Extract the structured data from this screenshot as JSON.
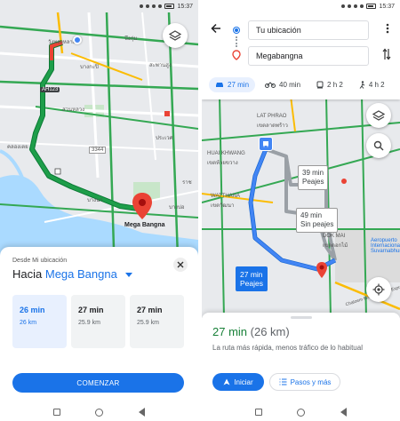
{
  "left": {
    "status": {
      "time": "15:37"
    },
    "map_labels": [
      "วังทองหลาง",
      "บางกะปิ",
      "บึงกุ่ม",
      "สะพานสูง",
      "AH123",
      "สวนหลวง",
      "ประเวศ",
      "คลองเตย",
      "3344",
      "บางนา",
      "Mega Bangna",
      "บางบ่อ",
      "ราช"
    ],
    "sheet": {
      "from_label": "Desde Mi ubicación",
      "to_prefix": "Hacia",
      "to_destination": "Mega Bangna",
      "options": [
        {
          "time": "26 min",
          "distance": "26 km"
        },
        {
          "time": "27 min",
          "distance": "25.9 km"
        },
        {
          "time": "27 min",
          "distance": "25.9 km"
        }
      ],
      "start_button": "COMENZAR"
    }
  },
  "right": {
    "status": {
      "time": "15:37"
    },
    "origin": "Tu ubicación",
    "destination": "Megabangna",
    "modes": [
      {
        "icon": "car-icon",
        "label": "27 min"
      },
      {
        "icon": "motorcycle-icon",
        "label": "40 min"
      },
      {
        "icon": "transit-icon",
        "label": "2 h 2"
      },
      {
        "icon": "walk-icon",
        "label": "4 h 2"
      }
    ],
    "map_labels": [
      "LAT PHRAO",
      "เขตลาดพร้าว",
      "HUAI KHWANG",
      "เขตห้วยขวาง",
      "WATTHANA",
      "เขตวัฒนา",
      "DOK MAI",
      "เขตดอกไม้",
      "Aeropuerto Internacional Suvarnabhumi",
      "Chaloem Maha Nakhon Expressway"
    ],
    "callouts": {
      "alt1_time": "39 min",
      "alt1_note": "Peajes",
      "alt2_time": "49 min",
      "alt2_note": "Sin peajes",
      "main_time": "27 min",
      "main_note": "Peajes"
    },
    "summary": {
      "time": "27 min",
      "distance": "(26 km)",
      "description": "La ruta más rápida, menos tráfico de lo habitual",
      "start_button": "Iniciar",
      "steps_button": "Pasos y más"
    }
  },
  "colors": {
    "route_green": "#1e9e4a",
    "route_blue": "#4285f4",
    "accent": "#1a73e8",
    "pin_red": "#ea4335"
  }
}
